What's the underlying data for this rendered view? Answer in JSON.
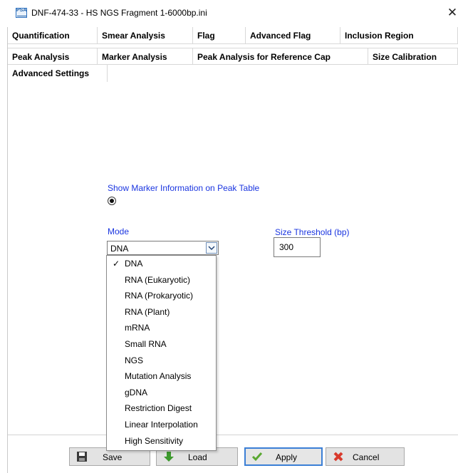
{
  "window": {
    "title": "DNF-474-33 - HS NGS Fragment 1-6000bp.ini",
    "close_glyph": "✕",
    "icon_text": "PSA"
  },
  "tabs": {
    "row1": [
      "Quantification",
      "Smear Analysis",
      "Flag",
      "Advanced Flag",
      "Inclusion Region"
    ],
    "row2": [
      "Peak Analysis",
      "Marker Analysis",
      "Peak Analysis for Reference Cap",
      "Size Calibration"
    ],
    "row3": [
      "Advanced Settings"
    ],
    "active": "Advanced Settings"
  },
  "settings": {
    "show_marker_label": "Show Marker Information on Peak Table",
    "show_marker_selected": true,
    "mode_label": "Mode",
    "mode_value": "DNA",
    "size_threshold_label": "Size Threshold (bp)",
    "size_threshold_value": "300"
  },
  "mode_dropdown": {
    "open": true,
    "selected": "DNA",
    "check_glyph": "✓",
    "options": [
      "DNA",
      "RNA (Eukaryotic)",
      "RNA (Prokaryotic)",
      "RNA (Plant)",
      "mRNA",
      "Small RNA",
      "NGS",
      "Mutation Analysis",
      "gDNA",
      "Restriction Digest",
      "Linear Interpolation",
      "High Sensitivity"
    ]
  },
  "buttons": {
    "save": "Save",
    "load": "Load",
    "apply": "Apply",
    "cancel": "Cancel"
  },
  "colors": {
    "label_blue": "#1a35e0",
    "apply_focus_border": "#3b7fd6",
    "cancel_icon": "#d83a2c",
    "apply_icon": "#5aa832",
    "load_icon": "#3d9a2e"
  }
}
